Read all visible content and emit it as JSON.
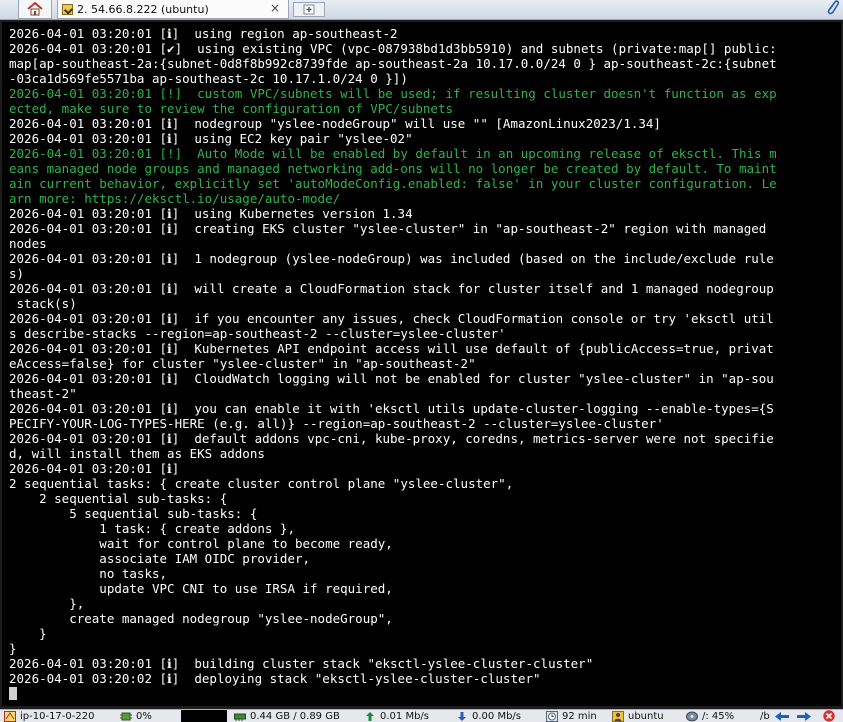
{
  "tabbar": {
    "tab_title": "2. 54.66.8.222 (ubuntu)",
    "close_glyph": "×"
  },
  "terminal": {
    "lines": [
      {
        "text": "2026-04-01 03:20:01 [ℹ]  using region ap-southeast-2",
        "color": "white"
      },
      {
        "text": "2026-04-01 03:20:01 [✔]  using existing VPC (vpc-087938bd1d3bb5910) and subnets (private:map[] public:",
        "color": "white"
      },
      {
        "text": "map[ap-southeast-2a:{subnet-0d8f8b992c8739fde ap-southeast-2a 10.17.0.0/24 0 } ap-southeast-2c:{subnet",
        "color": "white"
      },
      {
        "text": "-03ca1d569fe5571ba ap-southeast-2c 10.17.1.0/24 0 }])",
        "color": "white"
      },
      {
        "text": "2026-04-01 03:20:01 [!]  custom VPC/subnets will be used; if resulting cluster doesn't function as exp",
        "color": "green"
      },
      {
        "text": "ected, make sure to review the configuration of VPC/subnets",
        "color": "green"
      },
      {
        "text": "2026-04-01 03:20:01 [ℹ]  nodegroup \"yslee-nodeGroup\" will use \"\" [AmazonLinux2023/1.34]",
        "color": "white"
      },
      {
        "text": "2026-04-01 03:20:01 [ℹ]  using EC2 key pair \"yslee-02\"",
        "color": "white"
      },
      {
        "text": "2026-04-01 03:20:01 [!]  Auto Mode will be enabled by default in an upcoming release of eksctl. This m",
        "color": "green"
      },
      {
        "text": "eans managed node groups and managed networking add-ons will no longer be created by default. To maint",
        "color": "green"
      },
      {
        "text": "ain current behavior, explicitly set 'autoModeConfig.enabled: false' in your cluster configuration. Le",
        "color": "green"
      },
      {
        "text": "arn more: https://eksctl.io/usage/auto-mode/",
        "color": "green"
      },
      {
        "text": "2026-04-01 03:20:01 [ℹ]  using Kubernetes version 1.34",
        "color": "white"
      },
      {
        "text": "2026-04-01 03:20:01 [ℹ]  creating EKS cluster \"yslee-cluster\" in \"ap-southeast-2\" region with managed",
        "color": "white"
      },
      {
        "text": "nodes",
        "color": "white"
      },
      {
        "text": "2026-04-01 03:20:01 [ℹ]  1 nodegroup (yslee-nodeGroup) was included (based on the include/exclude rule",
        "color": "white"
      },
      {
        "text": "s)",
        "color": "white"
      },
      {
        "text": "2026-04-01 03:20:01 [ℹ]  will create a CloudFormation stack for cluster itself and 1 managed nodegroup",
        "color": "white"
      },
      {
        "text": " stack(s)",
        "color": "white"
      },
      {
        "text": "2026-04-01 03:20:01 [ℹ]  if you encounter any issues, check CloudFormation console or try 'eksctl util",
        "color": "white"
      },
      {
        "text": "s describe-stacks --region=ap-southeast-2 --cluster=yslee-cluster'",
        "color": "white"
      },
      {
        "text": "2026-04-01 03:20:01 [ℹ]  Kubernetes API endpoint access will use default of {publicAccess=true, privat",
        "color": "white"
      },
      {
        "text": "eAccess=false} for cluster \"yslee-cluster\" in \"ap-southeast-2\"",
        "color": "white"
      },
      {
        "text": "2026-04-01 03:20:01 [ℹ]  CloudWatch logging will not be enabled for cluster \"yslee-cluster\" in \"ap-sou",
        "color": "white"
      },
      {
        "text": "theast-2\"",
        "color": "white"
      },
      {
        "text": "2026-04-01 03:20:01 [ℹ]  you can enable it with 'eksctl utils update-cluster-logging --enable-types={S",
        "color": "white"
      },
      {
        "text": "PECIFY-YOUR-LOG-TYPES-HERE (e.g. all)} --region=ap-southeast-2 --cluster=yslee-cluster'",
        "color": "white"
      },
      {
        "text": "2026-04-01 03:20:01 [ℹ]  default addons vpc-cni, kube-proxy, coredns, metrics-server were not specifie",
        "color": "white"
      },
      {
        "text": "d, will install them as EKS addons",
        "color": "white"
      },
      {
        "text": "2026-04-01 03:20:01 [ℹ]",
        "color": "white"
      },
      {
        "text": "2 sequential tasks: { create cluster control plane \"yslee-cluster\",",
        "color": "white"
      },
      {
        "text": "    2 sequential sub-tasks: {",
        "color": "white"
      },
      {
        "text": "        5 sequential sub-tasks: {",
        "color": "white"
      },
      {
        "text": "            1 task: { create addons },",
        "color": "white"
      },
      {
        "text": "            wait for control plane to become ready,",
        "color": "white"
      },
      {
        "text": "            associate IAM OIDC provider,",
        "color": "white"
      },
      {
        "text": "            no tasks,",
        "color": "white"
      },
      {
        "text": "            update VPC CNI to use IRSA if required,",
        "color": "white"
      },
      {
        "text": "        },",
        "color": "white"
      },
      {
        "text": "        create managed nodegroup \"yslee-nodeGroup\",",
        "color": "white"
      },
      {
        "text": "    }",
        "color": "white"
      },
      {
        "text": "}",
        "color": "white"
      },
      {
        "text": "2026-04-01 03:20:01 [ℹ]  building cluster stack \"eksctl-yslee-cluster-cluster\"",
        "color": "white"
      },
      {
        "text": "2026-04-01 03:20:02 [ℹ]  deploying stack \"eksctl-yslee-cluster-cluster\"",
        "color": "white"
      }
    ],
    "colors": {
      "white": "#ffffff",
      "green": "#2fb34a"
    }
  },
  "statusbar": {
    "hostname": "ip-10-17-0-220",
    "cpu": "0%",
    "memory": "0.44 GB / 0.89 GB",
    "upload": "0.01 Mb/s",
    "download": "0.00 Mb/s",
    "uptime": "92 min",
    "user": "ubuntu",
    "disk": "/: 45%",
    "path": "/b"
  }
}
